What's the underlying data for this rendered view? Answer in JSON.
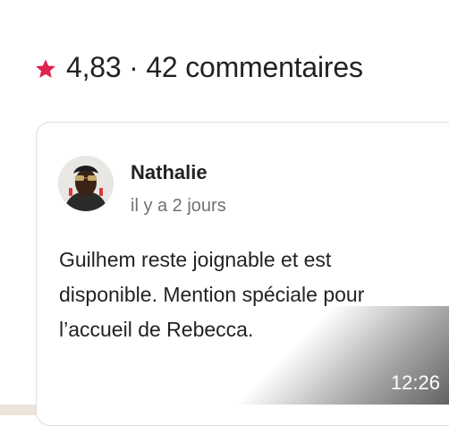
{
  "header": {
    "rating_summary": "4,83 · 42 commentaires",
    "star_icon": "star-icon",
    "accent_color": "#E0224E"
  },
  "review": {
    "avatar": "avatar",
    "name": "Nathalie",
    "date": "il y a 2 jours",
    "lines": [
      "Guilhem reste joignable et est",
      "disponible. Mention spéciale pour",
      "l’accueil de Rebecca."
    ]
  },
  "overlay": {
    "timestamp": "12:26"
  }
}
